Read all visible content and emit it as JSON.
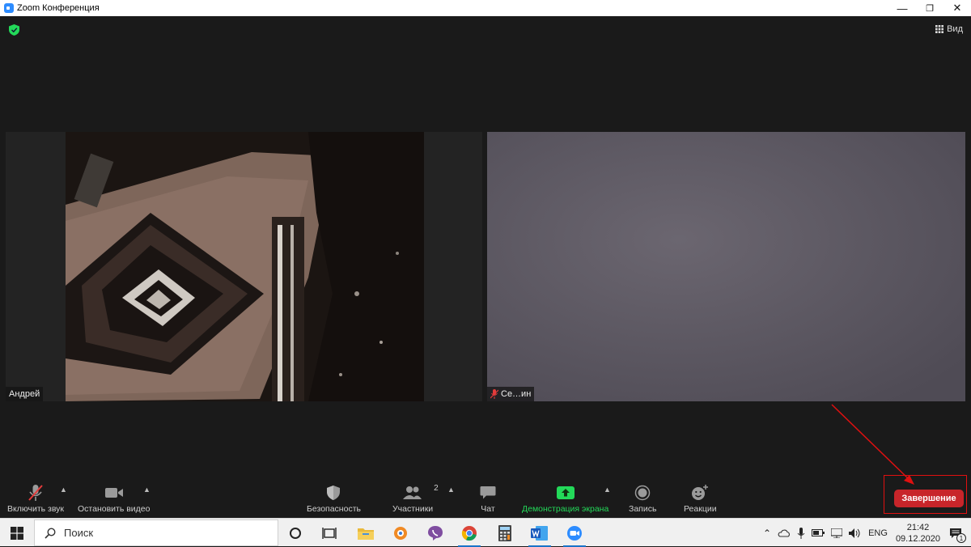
{
  "window": {
    "title": "Zoom Конференция",
    "controls": [
      "minimize-icon",
      "restore-icon",
      "close-icon"
    ]
  },
  "header": {
    "view_label": "Вид",
    "encryption_icon": "shield-check-icon",
    "encryption_color": "#23d959"
  },
  "participants": [
    {
      "name": "Андрей",
      "muted": false
    },
    {
      "name": "Се…ин",
      "muted": true
    }
  ],
  "toolbar": {
    "mute_label": "Включить звук",
    "video_label": "Остановить видео",
    "security_label": "Безопасность",
    "participants_label": "Участники",
    "participants_count": "2",
    "chat_label": "Чат",
    "share_label": "Демонстрация экрана",
    "record_label": "Запись",
    "reactions_label": "Реакции",
    "end_label": "Завершение",
    "share_color": "#23d959",
    "end_color": "#c8252a",
    "highlight_color": "#e01010"
  },
  "taskbar": {
    "search_placeholder": "Поиск",
    "apps": [
      "cortana-icon",
      "task-view-icon",
      "file-explorer-icon",
      "app-icon",
      "viber-icon",
      "chrome-icon",
      "calculator-icon",
      "word-icon",
      "zoom-icon"
    ],
    "language": "ENG",
    "time": "21:42",
    "date": "09.12.2020",
    "notifications_count": "1"
  }
}
